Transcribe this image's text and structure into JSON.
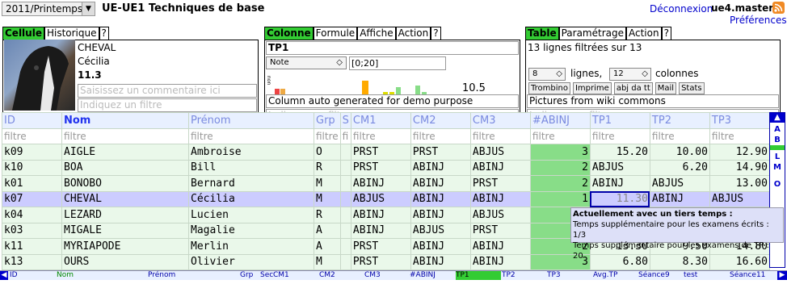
{
  "header": {
    "semester": "2011/Printemps",
    "ue_title": "UE-UE1 Techniques de base",
    "logout_label": "Déconnexion",
    "username": "ue4.master",
    "preferences_label": "Préférences"
  },
  "cell_panel": {
    "tabs": [
      "Cellule",
      "Historique",
      "?"
    ],
    "last_name": "CHEVAL",
    "first_name": "Cécilia",
    "value": "11.3",
    "comment_placeholder": "Saisissez un commentaire ici",
    "filter_placeholder": "Indiquez un filtre"
  },
  "column_panel": {
    "tabs": [
      "Colonne",
      "Formule",
      "Affiche",
      "Action",
      "?"
    ],
    "column_name": "TP1",
    "type_select": "Note",
    "range": "[0;20]",
    "histogram_labels": [
      "non",
      "abj",
      "pre",
      "oui",
      "non",
      "0",
      "1",
      "2",
      "3",
      "4",
      "5",
      "6",
      "7",
      "8",
      "9",
      "10",
      "11",
      "12",
      "13",
      "14",
      "15",
      "16",
      "17",
      "18",
      "19",
      "20"
    ],
    "average": "10.5",
    "comment": "Column auto generated for demo purpose",
    "filter_placeholder": "Indiquez un filtre"
  },
  "table_panel": {
    "tabs": [
      "Table",
      "Paramétrage",
      "Action",
      "?"
    ],
    "status": "13 lignes filtrées sur 13",
    "lines_value": "8",
    "lines_label": "lignes,",
    "cols_value": "12",
    "cols_label": "colonnes",
    "buttons": [
      "Trombino",
      "Imprime",
      "abj da tt",
      "Mail",
      "Stats"
    ],
    "comment": "Pictures from wiki commons",
    "filter_placeholder": "Indiquez un filtre"
  },
  "grid": {
    "headers": [
      "ID",
      "Nom",
      "Prénom",
      "Grp",
      "S",
      "CM1",
      "CM2",
      "CM3",
      "#ABINJ",
      "TP1",
      "TP2",
      "TP3"
    ],
    "filters": [
      "filtre",
      "filtre",
      "filtre",
      "filtre",
      "fi",
      "filtre",
      "filtre",
      "filtre",
      "filtre",
      "filtre",
      "filtre",
      "filtre"
    ],
    "rows": [
      [
        "k09",
        "AIGLE",
        "Ambroise",
        "O",
        "",
        "PRST",
        "PRST",
        "ABJUS",
        "3",
        "15.20",
        "10.00",
        "12.90"
      ],
      [
        "k10",
        "BOA",
        "Bill",
        "R",
        "",
        "PRST",
        "ABINJ",
        "ABINJ",
        "2",
        "ABJUS",
        "6.20",
        "14.90"
      ],
      [
        "k01",
        "BONOBO",
        "Bernard",
        "M",
        "",
        "ABINJ",
        "ABINJ",
        "PRST",
        "2",
        "ABINJ",
        "ABJUS",
        "13.00"
      ],
      [
        "k07",
        "CHEVAL",
        "Cécilia",
        "M",
        "",
        "ABJUS",
        "ABINJ",
        "ABINJ",
        "1",
        "11.30",
        "ABINJ",
        "ABJUS"
      ],
      [
        "k04",
        "LEZARD",
        "Lucien",
        "R",
        "",
        "ABINJ",
        "ABINJ",
        "ABJUS",
        "",
        "",
        "",
        ""
      ],
      [
        "k03",
        "MIGALE",
        "Magalie",
        "A",
        "",
        "ABINJ",
        "ABJUS",
        "PRST",
        "",
        "",
        "",
        ""
      ],
      [
        "k11",
        "MYRIAPODE",
        "Merlin",
        "A",
        "",
        "PRST",
        "ABINJ",
        "ABINJ",
        "2",
        "13.30",
        "9.50",
        "14.80"
      ],
      [
        "k13",
        "OURS",
        "Olivier",
        "M",
        "",
        "PRST",
        "ABINJ",
        "ABINJ",
        "3",
        "6.80",
        "8.30",
        "16.60"
      ]
    ]
  },
  "side_nav": [
    "A",
    "B",
    "C",
    "L",
    "M",
    "O"
  ],
  "tooltip": {
    "title": "Actuellement avec un tiers temps :",
    "line1": "Temps supplémentaire pour les examens écrits : 1/3",
    "line2": "Temps supplémentaire pour les examens de TP : 20"
  },
  "bottom_bar": [
    "ID",
    "Nom",
    "Prénom",
    "Grp",
    "Sec",
    "CM1",
    "CM2",
    "CM3",
    "#ABINJ",
    "TP1",
    "TP2",
    "TP3",
    "Avg.TP",
    "Séance9",
    "test",
    "Séance11"
  ],
  "colors": {
    "active_tab": "#33cc33",
    "abinj_cell": "#88dd88",
    "selected_row": "#ccccff",
    "row_bg": "#eaf8ea",
    "header_text": "#7a8ae0"
  }
}
